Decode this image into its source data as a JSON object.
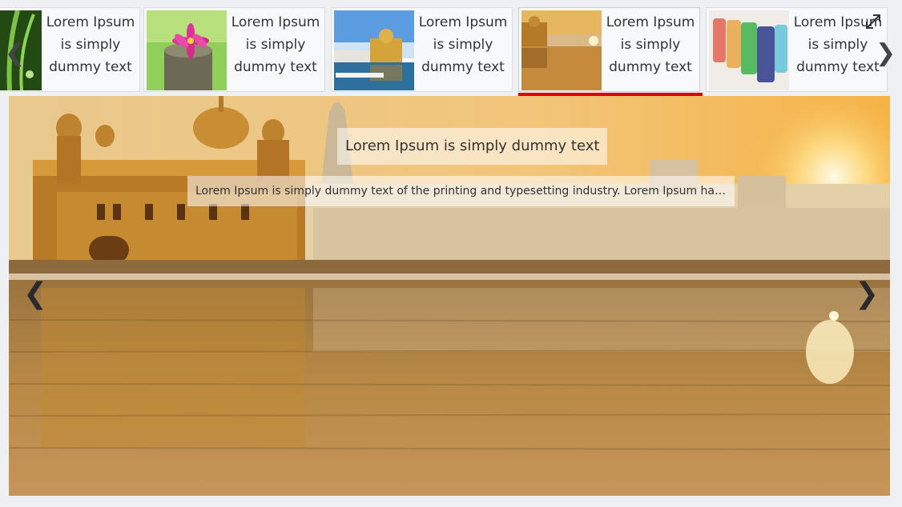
{
  "thumbnails": [
    {
      "caption": "Lorem Ipsum is simply dummy text",
      "image": "green-leaf"
    },
    {
      "caption": "Lorem Ipsum is simply dummy text",
      "image": "pink-flower"
    },
    {
      "caption": "Lorem Ipsum is simply dummy text",
      "image": "golden-temple-day"
    },
    {
      "caption": "Lorem Ipsum is simply dummy text",
      "image": "golden-temple-sunset",
      "active": true
    },
    {
      "caption": "Lorem Ipsum is simply dummy text",
      "image": "colored-glasses"
    }
  ],
  "slide": {
    "title": "Lorem Ipsum is simply dummy text",
    "description": "Lorem Ipsum is simply dummy text of the printing and typesetting industry. Lorem Ipsum has..."
  },
  "controls": {
    "prev_glyph": "❮",
    "next_glyph": "❯",
    "fullscreen_icon": "expand-icon"
  },
  "colors": {
    "accent": "#e00000",
    "background": "#eef0f3"
  }
}
